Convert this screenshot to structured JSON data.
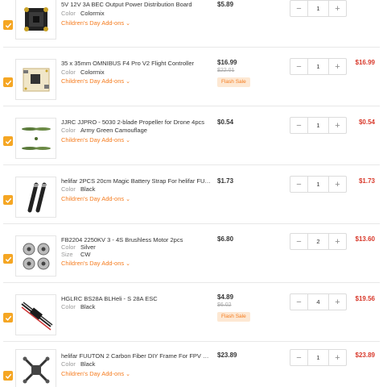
{
  "items": [
    {
      "icon": "pdb-board-image",
      "title": "5V 12V 3A BEC Output Power Distribution Board",
      "attrs": [
        {
          "key": "Color",
          "value": "Colormix"
        }
      ],
      "addon": "Children's Day Add-ons",
      "price": "$5.89",
      "qty": "1",
      "subtotal": ""
    },
    {
      "icon": "flight-controller-image",
      "title": "35 x 35mm OMNIBUS F4 Pro V2 Flight Controller",
      "attrs": [
        {
          "key": "Color",
          "value": "Colormix"
        }
      ],
      "addon": "Children's Day Add-ons",
      "price": "$16.99",
      "old_price": "$22.01",
      "flash": "Flash Sale",
      "qty": "1",
      "subtotal": "$16.99"
    },
    {
      "icon": "propeller-image",
      "title": "JJRC JJPRO - 5030 2-blade Propeller for Drone 4pcs",
      "attrs": [
        {
          "key": "Color",
          "value": "Army Green Camouflage"
        }
      ],
      "addon": "Children's Day Add-ons",
      "price": "$0.54",
      "qty": "1",
      "subtotal": "$0.54"
    },
    {
      "icon": "battery-strap-image",
      "title": "helifar 2PCS 20cm Magic Battery Strap For helifar FUU...",
      "attrs": [
        {
          "key": "Color",
          "value": "Black"
        }
      ],
      "addon": "Children's Day Add-ons",
      "price": "$1.73",
      "qty": "1",
      "subtotal": "$1.73"
    },
    {
      "icon": "brushless-motor-image",
      "title": "FB2204 2250KV 3 - 4S Brushless Motor 2pcs",
      "attrs": [
        {
          "key": "Color",
          "value": "Silver"
        },
        {
          "key": "Size",
          "value": "CW"
        }
      ],
      "addon": "Children's Day Add-ons",
      "price": "$6.80",
      "qty": "2",
      "subtotal": "$13.60"
    },
    {
      "icon": "esc-image",
      "title": "HGLRC BS28A BLHeli - S 28A ESC",
      "attrs": [
        {
          "key": "Color",
          "value": "Black"
        }
      ],
      "price": "$4.89",
      "old_price": "$6.02",
      "flash": "Flash Sale",
      "qty": "4",
      "subtotal": "$19.56"
    },
    {
      "icon": "drone-frame-image",
      "title": "helifar FUUTON 2 Carbon Fiber DIY Frame For FPV Rac...",
      "attrs": [
        {
          "key": "Color",
          "value": "Black"
        }
      ],
      "addon": "Children's Day Add-ons",
      "price": "$23.89",
      "qty": "1",
      "subtotal": "$23.89"
    }
  ],
  "colors": {
    "accent": "#f5a623",
    "addon": "#f57c1f",
    "subtotal": "#d8392b"
  },
  "icons": {
    "check": "check-icon",
    "minus": "minus-icon",
    "plus": "plus-icon",
    "chevron": "chevron-down-icon"
  }
}
